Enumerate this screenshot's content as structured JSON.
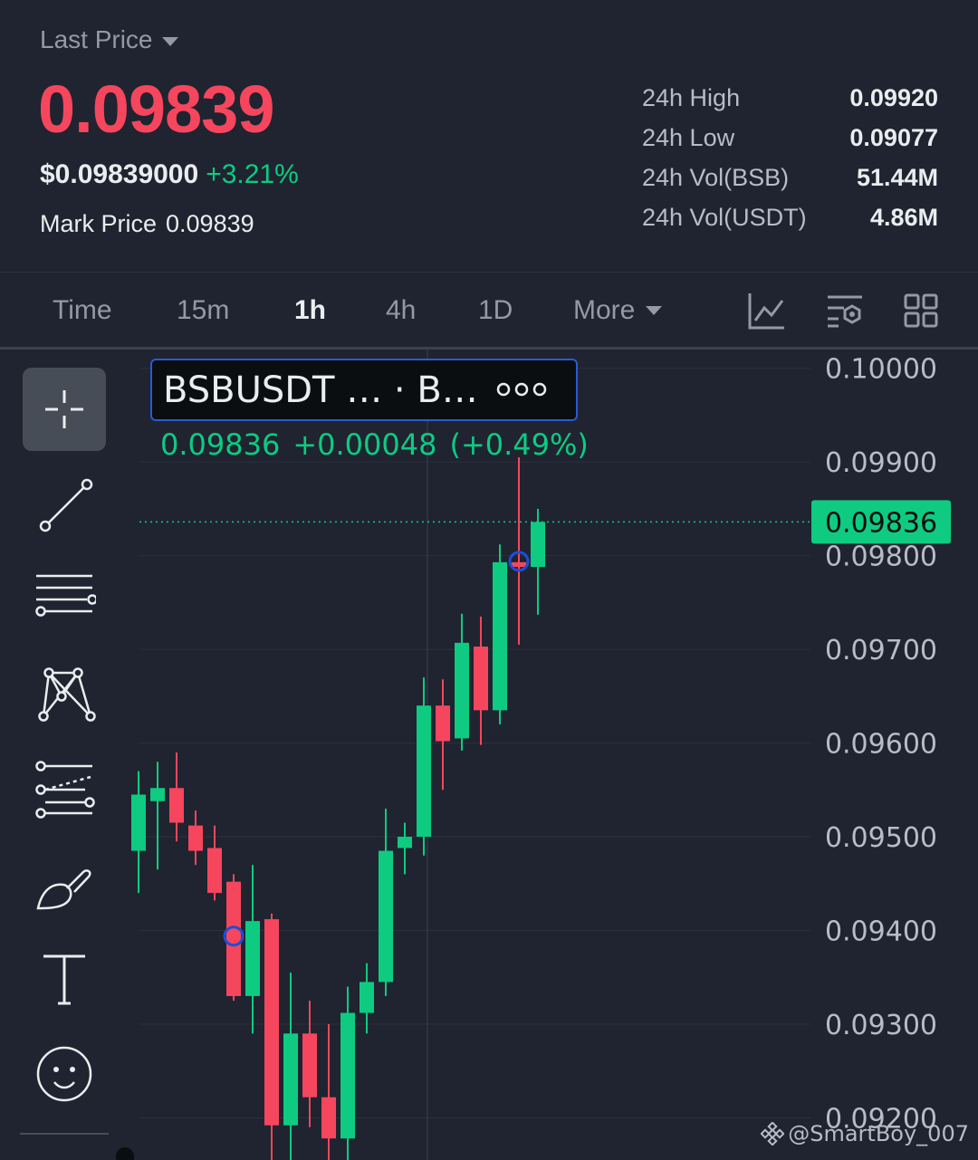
{
  "header": {
    "last_price_label": "Last Price",
    "last_price": "0.09839",
    "usd_price": "$0.09839000",
    "change_pct": "+3.21%",
    "mark_price_label": "Mark Price",
    "mark_price": "0.09839"
  },
  "stats": [
    {
      "label": "24h High",
      "value": "0.09920"
    },
    {
      "label": "24h Low",
      "value": "0.09077"
    },
    {
      "label": "24h Vol(BSB)",
      "value": "51.44M"
    },
    {
      "label": "24h Vol(USDT)",
      "value": "4.86M"
    }
  ],
  "timeframes": {
    "time": "Time",
    "m15": "15m",
    "h1": "1h",
    "h4": "4h",
    "d1": "1D",
    "more": "More"
  },
  "colors": {
    "background": "#1f2430",
    "up": "#0ecb81",
    "down": "#f6465d",
    "legend_border": "#2a5ad6"
  },
  "legend": {
    "title": "BSBUSDT … · B…",
    "close": "0.09836",
    "change": "+0.00048",
    "change_pct": "(+0.49%)"
  },
  "drawing_tools": [
    "crosshair-icon",
    "trend-line-icon",
    "horizontal-lines-icon",
    "pattern-icon",
    "fib-icon",
    "brush-icon",
    "text-icon",
    "emoji-icon"
  ],
  "watermark": "@SmartBoy_007",
  "chart_data": {
    "type": "candlestick",
    "ylim": [
      0.09155,
      0.1002
    ],
    "y_ticks": [
      "0.10000",
      "0.09900",
      "0.09800",
      "0.09700",
      "0.09600",
      "0.09500",
      "0.09400",
      "0.09300",
      "0.09200"
    ],
    "current_price_label": "0.09836",
    "current_price": 0.09836,
    "candles": [
      {
        "o": 0.09485,
        "h": 0.0957,
        "l": 0.0944,
        "c": 0.09545
      },
      {
        "o": 0.09538,
        "h": 0.0958,
        "l": 0.09465,
        "c": 0.09552
      },
      {
        "o": 0.09552,
        "h": 0.0959,
        "l": 0.09495,
        "c": 0.09515
      },
      {
        "o": 0.09512,
        "h": 0.09528,
        "l": 0.0947,
        "c": 0.09485
      },
      {
        "o": 0.09488,
        "h": 0.09512,
        "l": 0.09432,
        "c": 0.0944
      },
      {
        "o": 0.09452,
        "h": 0.0946,
        "l": 0.09325,
        "c": 0.0933
      },
      {
        "o": 0.0933,
        "h": 0.0947,
        "l": 0.0929,
        "c": 0.0941
      },
      {
        "o": 0.09412,
        "h": 0.09418,
        "l": 0.09105,
        "c": 0.09192
      },
      {
        "o": 0.09192,
        "h": 0.09355,
        "l": 0.0915,
        "c": 0.0929
      },
      {
        "o": 0.0929,
        "h": 0.09325,
        "l": 0.0919,
        "c": 0.09222
      },
      {
        "o": 0.09222,
        "h": 0.093,
        "l": 0.09105,
        "c": 0.09178
      },
      {
        "o": 0.09178,
        "h": 0.0934,
        "l": 0.09115,
        "c": 0.09312
      },
      {
        "o": 0.09312,
        "h": 0.09365,
        "l": 0.0929,
        "c": 0.09345
      },
      {
        "o": 0.09345,
        "h": 0.0953,
        "l": 0.0933,
        "c": 0.09485
      },
      {
        "o": 0.09488,
        "h": 0.09515,
        "l": 0.0946,
        "c": 0.095
      },
      {
        "o": 0.095,
        "h": 0.0967,
        "l": 0.0948,
        "c": 0.0964
      },
      {
        "o": 0.0964,
        "h": 0.09668,
        "l": 0.0955,
        "c": 0.09602
      },
      {
        "o": 0.09605,
        "h": 0.09738,
        "l": 0.09592,
        "c": 0.09707
      },
      {
        "o": 0.09703,
        "h": 0.09735,
        "l": 0.09598,
        "c": 0.09635
      },
      {
        "o": 0.09635,
        "h": 0.09812,
        "l": 0.0962,
        "c": 0.09793
      },
      {
        "o": 0.09793,
        "h": 0.09905,
        "l": 0.09705,
        "c": 0.09788
      },
      {
        "o": 0.09788,
        "h": 0.0985,
        "l": 0.09737,
        "c": 0.09836
      }
    ],
    "markers": [
      {
        "index": 5,
        "price": 0.09394
      },
      {
        "index": 20,
        "price": 0.09794
      }
    ]
  }
}
